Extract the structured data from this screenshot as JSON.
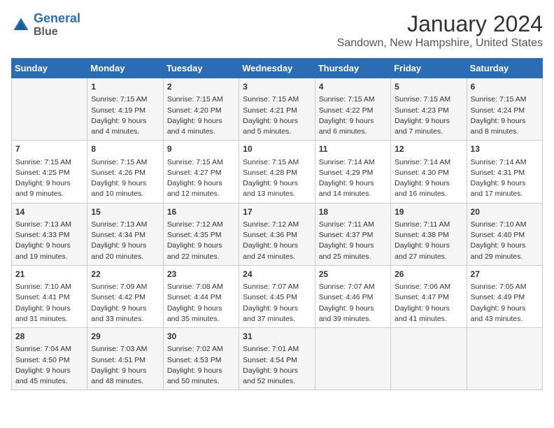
{
  "header": {
    "logo_line1": "General",
    "logo_line2": "Blue",
    "title": "January 2024",
    "subtitle": "Sandown, New Hampshire, United States"
  },
  "weekdays": [
    "Sunday",
    "Monday",
    "Tuesday",
    "Wednesday",
    "Thursday",
    "Friday",
    "Saturday"
  ],
  "weeks": [
    [
      {
        "day": "",
        "sunrise": "",
        "sunset": "",
        "daylight": ""
      },
      {
        "day": "1",
        "sunrise": "Sunrise: 7:15 AM",
        "sunset": "Sunset: 4:19 PM",
        "daylight": "Daylight: 9 hours and 4 minutes."
      },
      {
        "day": "2",
        "sunrise": "Sunrise: 7:15 AM",
        "sunset": "Sunset: 4:20 PM",
        "daylight": "Daylight: 9 hours and 4 minutes."
      },
      {
        "day": "3",
        "sunrise": "Sunrise: 7:15 AM",
        "sunset": "Sunset: 4:21 PM",
        "daylight": "Daylight: 9 hours and 5 minutes."
      },
      {
        "day": "4",
        "sunrise": "Sunrise: 7:15 AM",
        "sunset": "Sunset: 4:22 PM",
        "daylight": "Daylight: 9 hours and 6 minutes."
      },
      {
        "day": "5",
        "sunrise": "Sunrise: 7:15 AM",
        "sunset": "Sunset: 4:23 PM",
        "daylight": "Daylight: 9 hours and 7 minutes."
      },
      {
        "day": "6",
        "sunrise": "Sunrise: 7:15 AM",
        "sunset": "Sunset: 4:24 PM",
        "daylight": "Daylight: 9 hours and 8 minutes."
      }
    ],
    [
      {
        "day": "7",
        "sunrise": "Sunrise: 7:15 AM",
        "sunset": "Sunset: 4:25 PM",
        "daylight": "Daylight: 9 hours and 9 minutes."
      },
      {
        "day": "8",
        "sunrise": "Sunrise: 7:15 AM",
        "sunset": "Sunset: 4:26 PM",
        "daylight": "Daylight: 9 hours and 10 minutes."
      },
      {
        "day": "9",
        "sunrise": "Sunrise: 7:15 AM",
        "sunset": "Sunset: 4:27 PM",
        "daylight": "Daylight: 9 hours and 12 minutes."
      },
      {
        "day": "10",
        "sunrise": "Sunrise: 7:15 AM",
        "sunset": "Sunset: 4:28 PM",
        "daylight": "Daylight: 9 hours and 13 minutes."
      },
      {
        "day": "11",
        "sunrise": "Sunrise: 7:14 AM",
        "sunset": "Sunset: 4:29 PM",
        "daylight": "Daylight: 9 hours and 14 minutes."
      },
      {
        "day": "12",
        "sunrise": "Sunrise: 7:14 AM",
        "sunset": "Sunset: 4:30 PM",
        "daylight": "Daylight: 9 hours and 16 minutes."
      },
      {
        "day": "13",
        "sunrise": "Sunrise: 7:14 AM",
        "sunset": "Sunset: 4:31 PM",
        "daylight": "Daylight: 9 hours and 17 minutes."
      }
    ],
    [
      {
        "day": "14",
        "sunrise": "Sunrise: 7:13 AM",
        "sunset": "Sunset: 4:33 PM",
        "daylight": "Daylight: 9 hours and 19 minutes."
      },
      {
        "day": "15",
        "sunrise": "Sunrise: 7:13 AM",
        "sunset": "Sunset: 4:34 PM",
        "daylight": "Daylight: 9 hours and 20 minutes."
      },
      {
        "day": "16",
        "sunrise": "Sunrise: 7:12 AM",
        "sunset": "Sunset: 4:35 PM",
        "daylight": "Daylight: 9 hours and 22 minutes."
      },
      {
        "day": "17",
        "sunrise": "Sunrise: 7:12 AM",
        "sunset": "Sunset: 4:36 PM",
        "daylight": "Daylight: 9 hours and 24 minutes."
      },
      {
        "day": "18",
        "sunrise": "Sunrise: 7:11 AM",
        "sunset": "Sunset: 4:37 PM",
        "daylight": "Daylight: 9 hours and 25 minutes."
      },
      {
        "day": "19",
        "sunrise": "Sunrise: 7:11 AM",
        "sunset": "Sunset: 4:38 PM",
        "daylight": "Daylight: 9 hours and 27 minutes."
      },
      {
        "day": "20",
        "sunrise": "Sunrise: 7:10 AM",
        "sunset": "Sunset: 4:40 PM",
        "daylight": "Daylight: 9 hours and 29 minutes."
      }
    ],
    [
      {
        "day": "21",
        "sunrise": "Sunrise: 7:10 AM",
        "sunset": "Sunset: 4:41 PM",
        "daylight": "Daylight: 9 hours and 31 minutes."
      },
      {
        "day": "22",
        "sunrise": "Sunrise: 7:09 AM",
        "sunset": "Sunset: 4:42 PM",
        "daylight": "Daylight: 9 hours and 33 minutes."
      },
      {
        "day": "23",
        "sunrise": "Sunrise: 7:08 AM",
        "sunset": "Sunset: 4:44 PM",
        "daylight": "Daylight: 9 hours and 35 minutes."
      },
      {
        "day": "24",
        "sunrise": "Sunrise: 7:07 AM",
        "sunset": "Sunset: 4:45 PM",
        "daylight": "Daylight: 9 hours and 37 minutes."
      },
      {
        "day": "25",
        "sunrise": "Sunrise: 7:07 AM",
        "sunset": "Sunset: 4:46 PM",
        "daylight": "Daylight: 9 hours and 39 minutes."
      },
      {
        "day": "26",
        "sunrise": "Sunrise: 7:06 AM",
        "sunset": "Sunset: 4:47 PM",
        "daylight": "Daylight: 9 hours and 41 minutes."
      },
      {
        "day": "27",
        "sunrise": "Sunrise: 7:05 AM",
        "sunset": "Sunset: 4:49 PM",
        "daylight": "Daylight: 9 hours and 43 minutes."
      }
    ],
    [
      {
        "day": "28",
        "sunrise": "Sunrise: 7:04 AM",
        "sunset": "Sunset: 4:50 PM",
        "daylight": "Daylight: 9 hours and 45 minutes."
      },
      {
        "day": "29",
        "sunrise": "Sunrise: 7:03 AM",
        "sunset": "Sunset: 4:51 PM",
        "daylight": "Daylight: 9 hours and 48 minutes."
      },
      {
        "day": "30",
        "sunrise": "Sunrise: 7:02 AM",
        "sunset": "Sunset: 4:53 PM",
        "daylight": "Daylight: 9 hours and 50 minutes."
      },
      {
        "day": "31",
        "sunrise": "Sunrise: 7:01 AM",
        "sunset": "Sunset: 4:54 PM",
        "daylight": "Daylight: 9 hours and 52 minutes."
      },
      {
        "day": "",
        "sunrise": "",
        "sunset": "",
        "daylight": ""
      },
      {
        "day": "",
        "sunrise": "",
        "sunset": "",
        "daylight": ""
      },
      {
        "day": "",
        "sunrise": "",
        "sunset": "",
        "daylight": ""
      }
    ]
  ]
}
